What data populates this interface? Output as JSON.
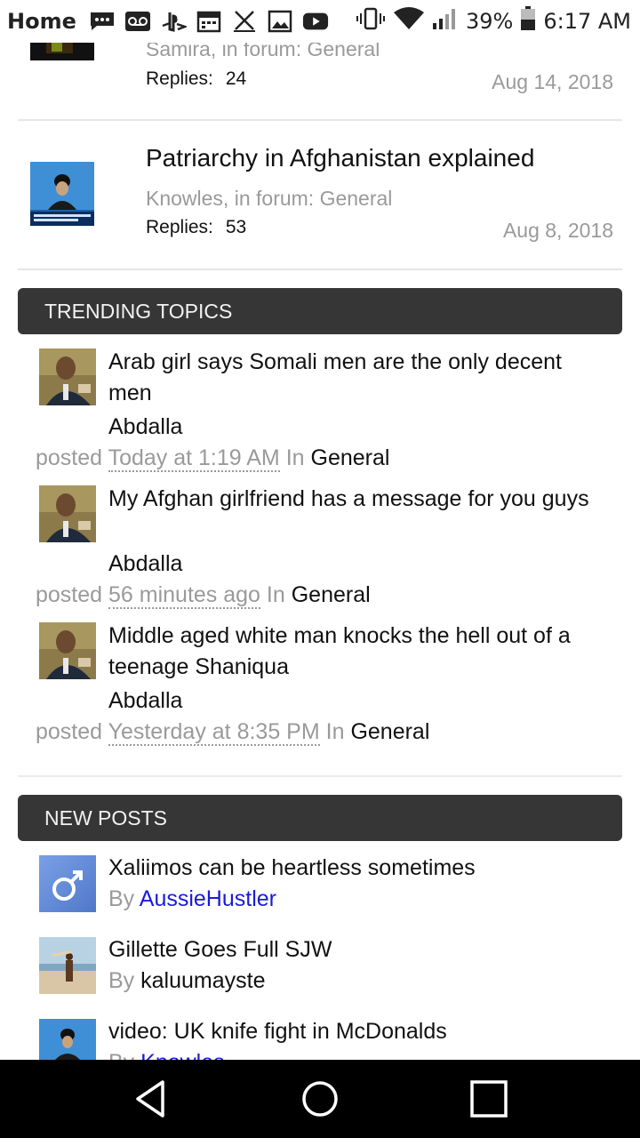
{
  "status_bar": {
    "home_label": "Home",
    "battery": "39%",
    "time": "6:17 AM"
  },
  "threads": [
    {
      "meta": "Samira, in forum: General",
      "replies_label": "Replies:",
      "replies": "24",
      "date": "Aug 14, 2018"
    },
    {
      "title": "Patriarchy in Afghanistan explained",
      "meta": "Knowles, in forum: General",
      "replies_label": "Replies:",
      "replies": "53",
      "date": "Aug 8, 2018"
    }
  ],
  "trending": {
    "heading": "TRENDING TOPICS",
    "items": [
      {
        "title": "Arab girl says Somali men are the only decent men",
        "author": "Abdalla",
        "posted": "posted",
        "when": "Today at 1:19 AM",
        "in": "In",
        "forum": "General"
      },
      {
        "title": "My Afghan girlfriend has a message for you guys",
        "author": "Abdalla",
        "posted": "posted",
        "when": "56 minutes ago",
        "in": "In",
        "forum": "General"
      },
      {
        "title": "Middle aged white man knocks the hell out of a teenage Shaniqua",
        "author": "Abdalla",
        "posted": "posted",
        "when": "Yesterday at 8:35 PM",
        "in": "In",
        "forum": "General"
      }
    ]
  },
  "new_posts": {
    "heading": "NEW POSTS",
    "items": [
      {
        "title": "Xaliimos can be heartless sometimes",
        "by": "By",
        "user": "AussieHustler"
      },
      {
        "title": "Gillette Goes Full SJW",
        "by": "By",
        "user": "kaluumayste"
      },
      {
        "title": "video: UK knife fight in McDonalds",
        "by": "By",
        "user": "Knowles"
      }
    ]
  },
  "colors": {
    "section_header_bg": "#363636",
    "link_blue": "#1a1adb",
    "muted_gray": "#9a9a9a"
  },
  "nav_bar": {
    "back_icon": "triangle-back-icon",
    "home_icon": "circle-home-icon",
    "recents_icon": "square-recents-icon"
  }
}
